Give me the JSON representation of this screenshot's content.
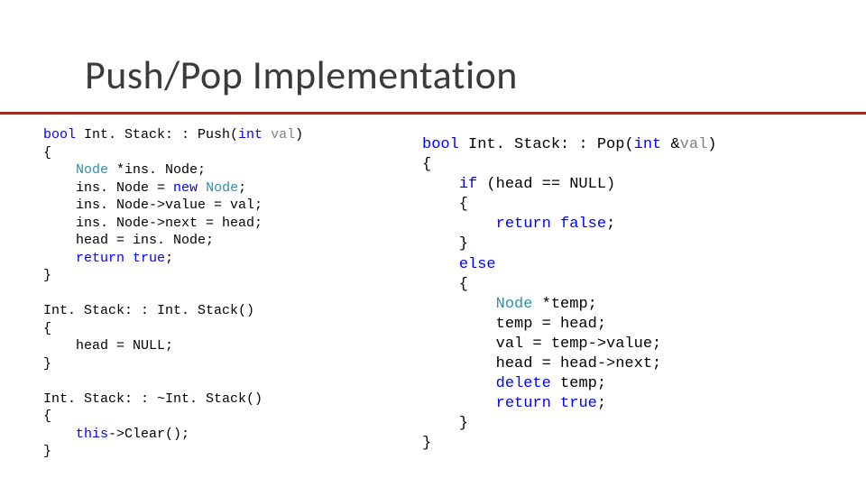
{
  "title": "Push/Pop Implementation",
  "left": {
    "l01a": "bool",
    "l01b": " Int. Stack: : Push(",
    "l01c": "int",
    "l01d": " val",
    "l01e": ")",
    "l02": "{",
    "l03a": "    ",
    "l03b": "Node",
    "l03c": " *ins. Node;",
    "l04a": "    ins. Node = ",
    "l04b": "new",
    "l04c": " ",
    "l04d": "Node",
    "l04e": ";",
    "l05": "    ins. Node->value = val;",
    "l06": "    ins. Node->next = head;",
    "l07": "    head = ins. Node;",
    "l08a": "    ",
    "l08b": "return",
    "l08c": " ",
    "l08d": "true",
    "l08e": ";",
    "l09": "}",
    "l10": "",
    "l11": "Int. Stack: : Int. Stack()",
    "l12": "{",
    "l13": "    head = NULL;",
    "l14": "}",
    "l15": "",
    "l16": "Int. Stack: : ~Int. Stack()",
    "l17": "{",
    "l18a": "    ",
    "l18b": "this",
    "l18c": "->Clear();",
    "l19": "}"
  },
  "right": {
    "r01a": "bool",
    "r01b": " Int. Stack: : Pop(",
    "r01c": "int",
    "r01d": " &",
    "r01e": "val",
    "r01f": ")",
    "r02": "{",
    "r03a": "    ",
    "r03b": "if",
    "r03c": " (head == NULL)",
    "r04": "    {",
    "r05a": "        ",
    "r05b": "return",
    "r05c": " ",
    "r05d": "false",
    "r05e": ";",
    "r06": "    }",
    "r07a": "    ",
    "r07b": "else",
    "r08": "    {",
    "r09a": "        ",
    "r09b": "Node",
    "r09c": " *temp;",
    "r10": "        temp = head;",
    "r11": "        val = temp->value;",
    "r12": "        head = head->next;",
    "r13a": "        ",
    "r13b": "delete",
    "r13c": " temp;",
    "r14a": "        ",
    "r14b": "return",
    "r14c": " ",
    "r14d": "true",
    "r14e": ";",
    "r15": "    }",
    "r16": "}"
  }
}
